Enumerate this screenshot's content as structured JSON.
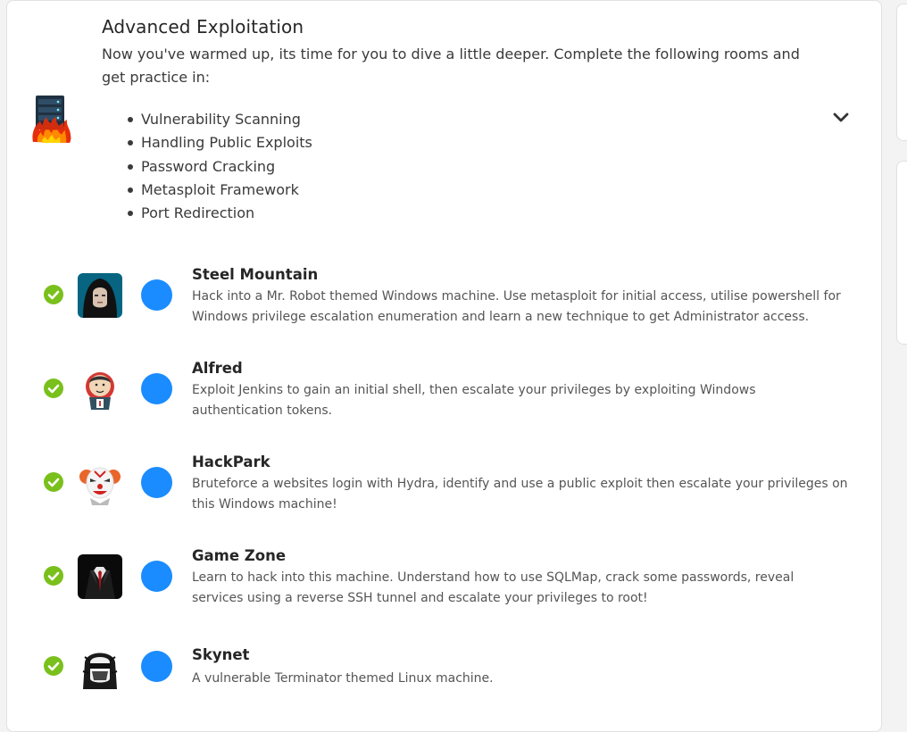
{
  "module": {
    "title": "Advanced Exploitation",
    "description": "Now you've warmed up, its time for you to dive a little deeper. Complete the following rooms and get practice in:",
    "icon": "burning-server-icon",
    "topics": [
      "Vulnerability Scanning",
      "Handling Public Exploits",
      "Password Cracking",
      "Metasploit Framework",
      "Port Redirection"
    ],
    "toggle_icon": "chevron-down-icon"
  },
  "colors": {
    "check": "#7ac01c",
    "dot": "#1a8cff",
    "card_border": "#e1e1e1"
  },
  "rooms": [
    {
      "title": "Steel Mountain",
      "description": "Hack into a Mr. Robot themed Windows machine. Use metasploit for initial access, utilise powershell for Windows privilege escalation enumeration and learn a new technique to get Administrator access.",
      "completed": true,
      "icon": "mr-robot-avatar"
    },
    {
      "title": "Alfred",
      "description": "Exploit Jenkins to gain an initial shell, then escalate your privileges by exploiting Windows authentication tokens.",
      "completed": true,
      "icon": "jenkins-butler-avatar"
    },
    {
      "title": "HackPark",
      "description": "Bruteforce a websites login with Hydra, identify and use a public exploit then escalate your privileges on this Windows machine!",
      "completed": true,
      "icon": "clown-avatar"
    },
    {
      "title": "Game Zone",
      "description": "Learn to hack into this machine. Understand how to use SQLMap, crack some passwords, reveal services using a reverse SSH tunnel and escalate your privileges to root!",
      "completed": true,
      "icon": "agent-suit-avatar"
    },
    {
      "title": "Skynet",
      "description": "A vulnerable Terminator themed Linux machine.",
      "completed": true,
      "icon": "terminator-avatar"
    }
  ]
}
